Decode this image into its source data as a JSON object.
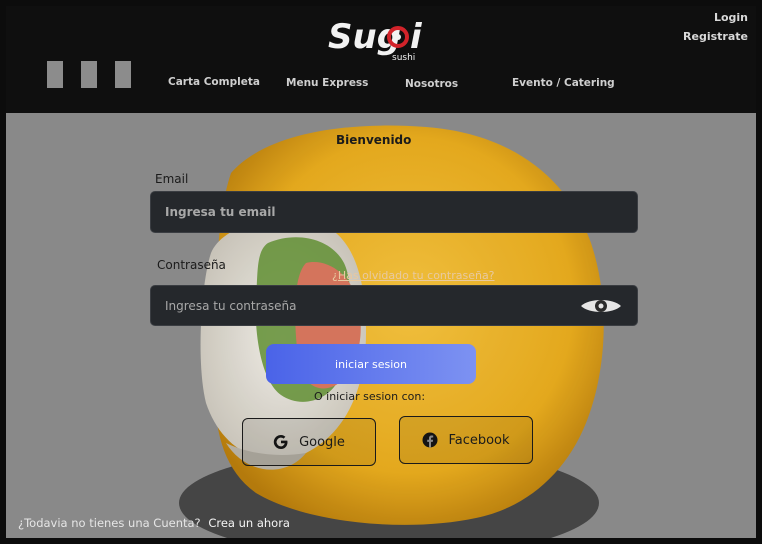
{
  "header": {
    "logo_text": "Sugoi",
    "logo_subtext": "sushi",
    "login": "Login",
    "register": "Registrate",
    "nav": [
      {
        "label": "Carta Completa"
      },
      {
        "label": "Menu Express"
      },
      {
        "label": "Nosotros"
      },
      {
        "label": "Evento / Catering"
      }
    ]
  },
  "form": {
    "welcome": "Bienvenido",
    "email_label": "Email",
    "email_placeholder": "Ingresa tu email",
    "password_label": "Contraseña",
    "forgot": "¿Has olvidado tu contraseña?",
    "password_placeholder": "Ingresa tu contraseña",
    "submit": "iniciar sesion",
    "or_text": "O iniciar sesion con:",
    "google": "Google",
    "facebook": "Facebook"
  },
  "footer": {
    "question": "¿Todavia no tienes una Cuenta?",
    "link": "Crea un ahora"
  },
  "colors": {
    "header_bg": "#0f0f0f",
    "main_bg": "#8a8a8a",
    "field_bg": "#25282c",
    "button_gradient_start": "#4a63e8",
    "button_gradient_end": "#7d92f2",
    "logo_accent": "#d2232a"
  },
  "icons": [
    "menu-bars-icon",
    "eye-icon",
    "google-icon",
    "facebook-icon"
  ]
}
